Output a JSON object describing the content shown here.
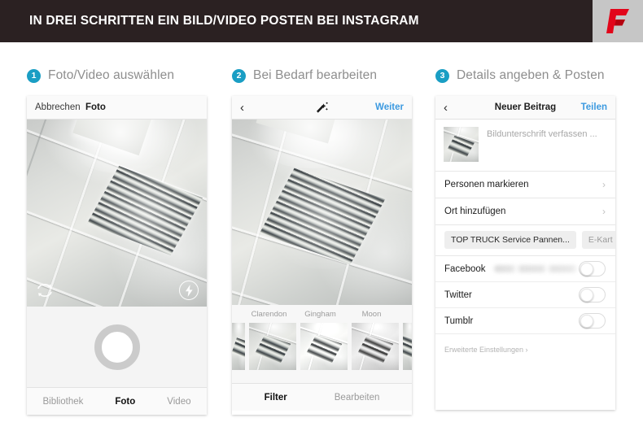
{
  "header": {
    "title": "IN DREI SCHRITTEN EIN BILD/VIDEO POSTEN BEI INSTAGRAM",
    "bar_color": "#2b2122",
    "logo_color": "#e2051a",
    "logo_bg": "#c6c6c6",
    "logo_letter": "F"
  },
  "accent_color": "#1a9ec4",
  "link_color": "#3c9ae0",
  "steps": [
    {
      "number": "1",
      "label": "Foto/Video auswählen"
    },
    {
      "number": "2",
      "label": "Bei Bedarf bearbeiten"
    },
    {
      "number": "3",
      "label": "Details angeben & Posten"
    }
  ],
  "panel1": {
    "nav": {
      "cancel": "Abbrechen",
      "title": "Foto"
    },
    "overlay": {
      "flip_icon": "camera-flip-icon",
      "flash_icon": "flash-icon"
    },
    "shutter": "shutter-button",
    "tabs": [
      {
        "label": "Bibliothek",
        "active": false
      },
      {
        "label": "Foto",
        "active": true
      },
      {
        "label": "Video",
        "active": false
      }
    ]
  },
  "panel2": {
    "nav": {
      "back_icon": "chevron-left-icon",
      "magic_icon": "magic-wand-icon",
      "next": "Weiter"
    },
    "filters": [
      "",
      "Clarendon",
      "Gingham",
      "Moon",
      ""
    ],
    "tabs": [
      {
        "label": "Filter",
        "active": true
      },
      {
        "label": "Bearbeiten",
        "active": false
      }
    ]
  },
  "panel3": {
    "nav": {
      "back_icon": "chevron-left-icon",
      "title": "Neuer Beitrag",
      "share": "Teilen"
    },
    "caption_placeholder": "Bildunterschrift verfassen ...",
    "rows": [
      {
        "label": "Personen markieren"
      },
      {
        "label": "Ort hinzufügen"
      }
    ],
    "location_chips": [
      {
        "label": "TOP TRUCK Service Pannen...",
        "muted": false
      },
      {
        "label": "E-Kart",
        "muted": true
      }
    ],
    "switches": [
      {
        "label": "Facebook",
        "on": false,
        "has_blurred_account": true
      },
      {
        "label": "Twitter",
        "on": false,
        "has_blurred_account": false
      },
      {
        "label": "Tumblr",
        "on": false,
        "has_blurred_account": false
      }
    ],
    "advanced": "Erweiterte Einstellungen ›"
  }
}
